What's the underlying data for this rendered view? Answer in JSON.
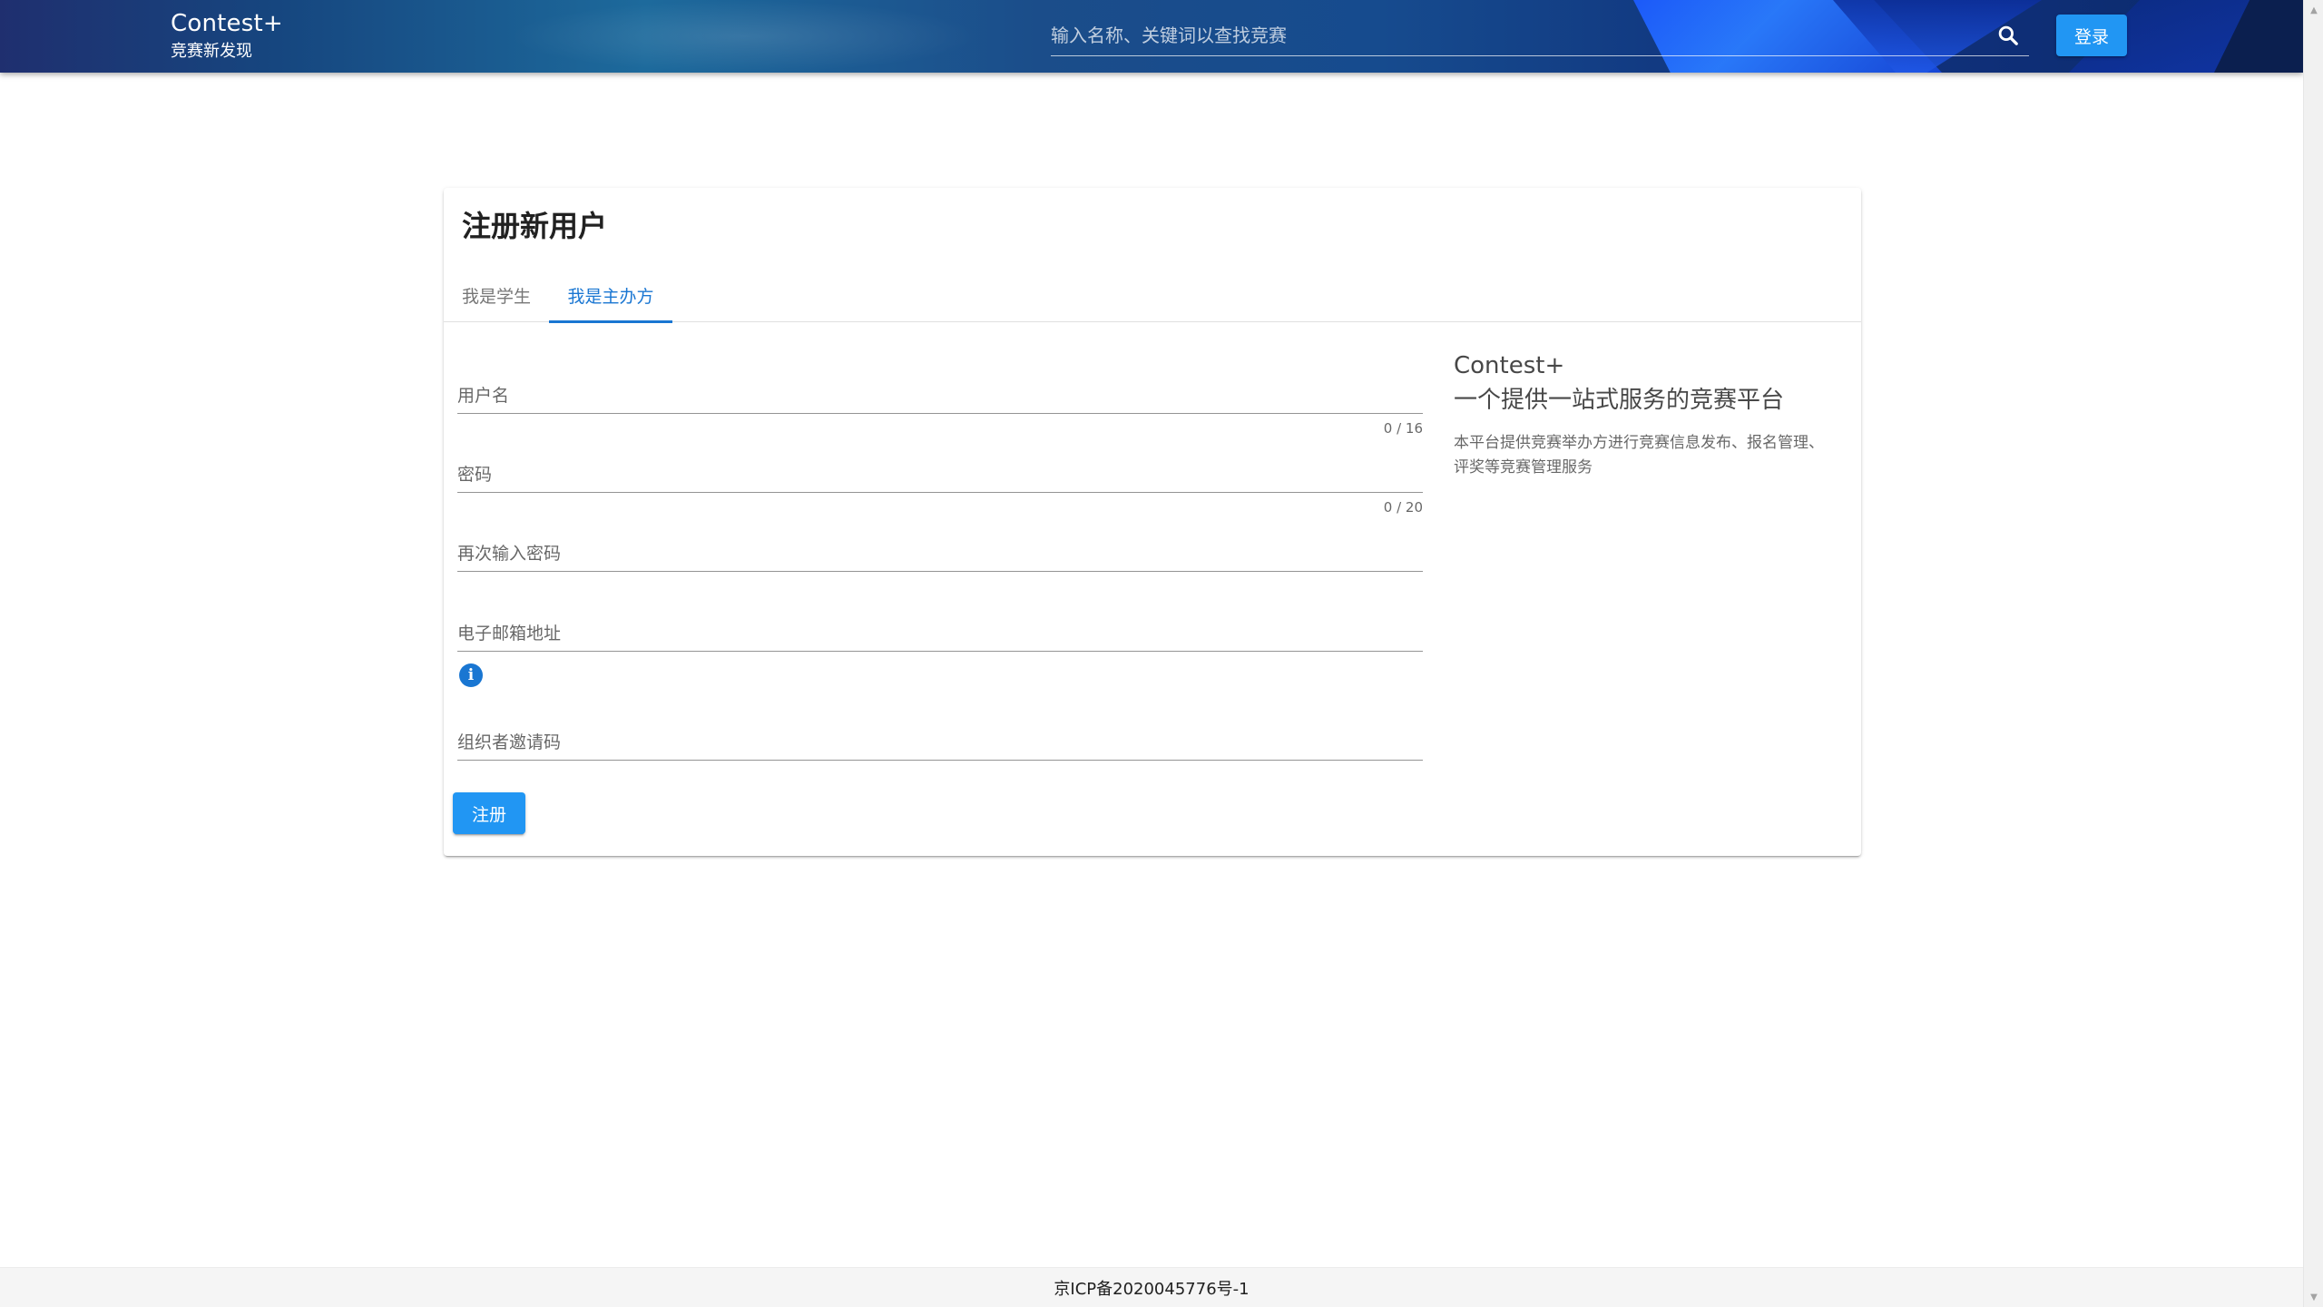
{
  "header": {
    "brand_title": "Contest+",
    "brand_subtitle": "竞赛新发现",
    "search_placeholder": "输入名称、关键词以查找竞赛",
    "search_icon": "search-icon",
    "login_label": "登录"
  },
  "card": {
    "title": "注册新用户",
    "tabs": [
      {
        "label": "我是学生",
        "active": false
      },
      {
        "label": "我是主办方",
        "active": true
      }
    ],
    "fields": {
      "username": {
        "placeholder": "用户名",
        "value": "",
        "counter": "0 / 16"
      },
      "password": {
        "placeholder": "密码",
        "value": "",
        "counter": "0 / 20"
      },
      "password_confirm": {
        "placeholder": "再次输入密码",
        "value": ""
      },
      "email": {
        "placeholder": "电子邮箱地址",
        "value": ""
      },
      "invite_code": {
        "placeholder": "组织者邀请码",
        "value": ""
      }
    },
    "info_icon": "info-icon",
    "register_label": "注册",
    "side": {
      "title": "Contest+",
      "subtitle": "一个提供一站式服务的竞赛平台",
      "description": "本平台提供竞赛举办方进行竞赛信息发布、报名管理、评奖等竞赛管理服务"
    }
  },
  "footer": {
    "icp": "京ICP备2020045776号-1"
  },
  "colors": {
    "primary": "#2196f3",
    "tab_active": "#1976d2",
    "header_dark": "#16467f"
  }
}
